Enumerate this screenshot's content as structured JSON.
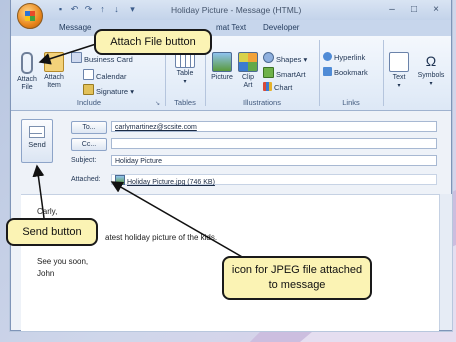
{
  "window": {
    "title": "Holiday Picture - Message (HTML)",
    "controls": [
      "–",
      "□",
      "×"
    ]
  },
  "quick_access": [
    "save-icon",
    "undo-icon",
    "redo-icon",
    "up-arrow-icon",
    "down-arrow-icon",
    "customize-icon"
  ],
  "tabs": [
    {
      "label": "Message"
    },
    {
      "label": "mat Text"
    },
    {
      "label": "Developer"
    }
  ],
  "ribbon": {
    "include": {
      "label": "Include",
      "attach_file": "Attach File",
      "attach_item": "Attach Item",
      "business_card": "Business Card",
      "calendar": "Calendar",
      "signature": "Signature ▾"
    },
    "tables": {
      "label": "Tables",
      "table": "Table"
    },
    "illustrations": {
      "label": "Illustrations",
      "picture": "Picture",
      "clip_art": "Clip Art",
      "shapes": "Shapes ▾",
      "smartart": "SmartArt",
      "chart": "Chart"
    },
    "links": {
      "label": "Links",
      "hyperlink": "Hyperlink",
      "bookmark": "Bookmark"
    },
    "text": {
      "label": "Text"
    },
    "symbols": {
      "label": "Symbols"
    }
  },
  "form": {
    "send": "Send",
    "to_button": "To...",
    "cc_button": "Cc...",
    "to_value": "carlymartinez@scsite.com",
    "cc_value": "",
    "subject_label": "Subject:",
    "subject_value": "Holiday Picture",
    "attached_label": "Attached:",
    "attachment": "Holiday Picture.jpg (746 KB)"
  },
  "body_lines": {
    "greeting": "Carly,",
    "line1": "atest holiday picture of the kids.",
    "line2": "See you soon,",
    "line3": "John"
  },
  "callouts": {
    "attach_file": "Attach File button",
    "send": "Send button",
    "jpeg": "icon for JPEG file attached to message"
  },
  "colors": {
    "callout_fill": "#fbf3b4",
    "ribbon_bg": "#dde8f6",
    "accent": "#2b5a9c"
  }
}
